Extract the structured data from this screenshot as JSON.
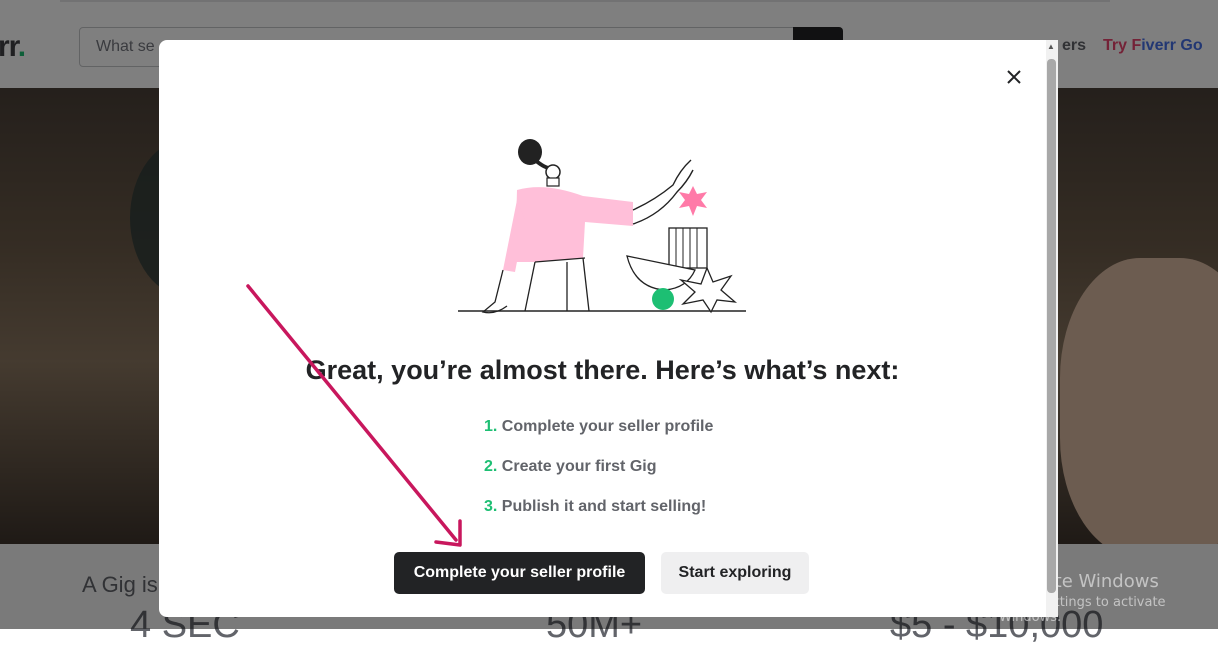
{
  "header": {
    "logo_text": "rr",
    "logo_dot": ".",
    "search_placeholder": "What se",
    "nav_sellers": "ers",
    "nav_try": "Try F",
    "nav_fiverr_go": "iverr Go"
  },
  "hero": {
    "stat_label": "A Gig is",
    "stat_1": "4 SEC",
    "stat_2": "50M+",
    "stat_3": "$5 - $10,000"
  },
  "modal": {
    "title": "Great, you’re almost there. Here’s what’s next:",
    "steps": [
      {
        "num": "1.",
        "text": " Complete your seller profile"
      },
      {
        "num": "2.",
        "text": " Create your first Gig"
      },
      {
        "num": "3.",
        "text": " Publish it and start selling!"
      }
    ],
    "primary_button": "Complete your seller profile",
    "secondary_button": "Start exploring",
    "close_icon": "close-icon"
  },
  "watermark": {
    "title": "Activate Windows",
    "subtitle": "Go to Settings to activate Windows."
  },
  "colors": {
    "accent_green": "#1dbf73",
    "dark": "#222325",
    "annotation_arrow": "#c8175d",
    "illustration_pink": "#ffbfd9"
  }
}
